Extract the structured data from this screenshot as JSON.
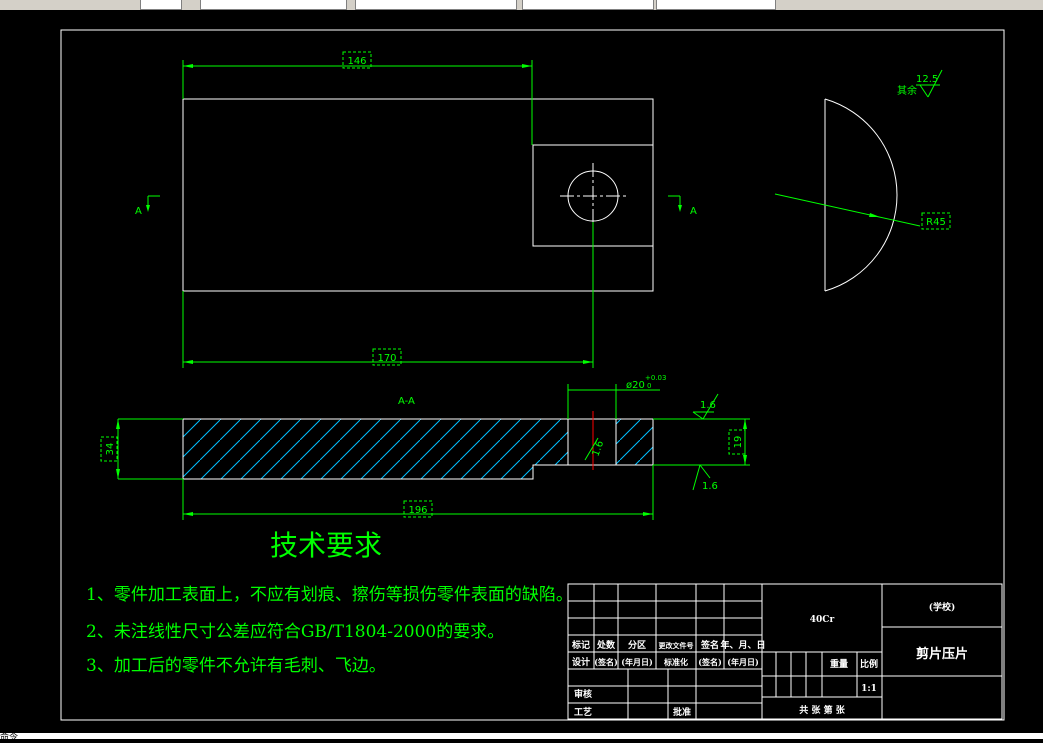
{
  "colors": {
    "background": "#000000",
    "outline": "#ffffff",
    "dimension": "#00ff00",
    "hatch": "#00bfff",
    "section_mark": "#ff0000"
  },
  "dimensions": {
    "top_width": "146",
    "bottom_length": "170",
    "section_length": "196",
    "thickness": "34",
    "step_height": "19",
    "hole_dia": "ø20",
    "hole_tol_upper": "+0.03",
    "hole_tol_lower": "0",
    "radius": "R45",
    "rough_top": "1.6",
    "rough_bottom": "1.6",
    "rough_hole": "1.6",
    "rough_other": "12.5",
    "rough_other_label": "其余"
  },
  "labels": {
    "section_a_left": "A",
    "section_a_right": "A",
    "section_view_title": "A-A"
  },
  "tech_requirements": {
    "title": "技术要求",
    "items": [
      "1、零件加工表面上，不应有划痕、擦伤等损伤零件表面的缺陷。",
      "2、未注线性尺寸公差应符合GB/T1804-2000的要求。",
      "3、加工后的零件不允许有毛刺、飞边。"
    ]
  },
  "title_block": {
    "material": "40Cr",
    "school": "(学校)",
    "part_name": "剪片压片",
    "row_headers": [
      "标记",
      "处数",
      "分区",
      "更改文件号",
      "签名",
      "年、月、日"
    ],
    "design_row": [
      "设计",
      "(签名)",
      "(年月日)",
      "标准化",
      "(签名)",
      "(年月日)"
    ],
    "weight_label": "重量",
    "scale_label": "比例",
    "scale": "1:1",
    "review": "审核",
    "process": "工艺",
    "approve": "批准",
    "sheets": "共  张  第  张"
  },
  "status": {
    "bottom_text": "命令"
  }
}
